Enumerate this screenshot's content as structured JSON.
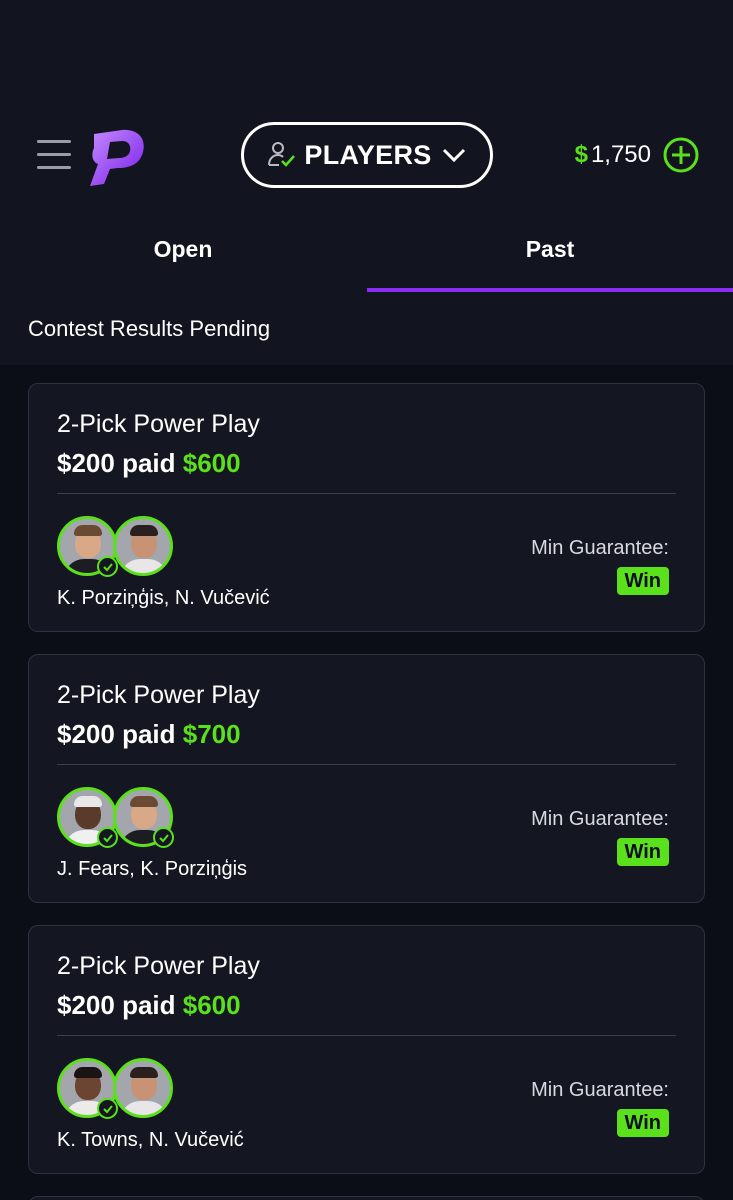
{
  "header": {
    "menu_icon": "hamburger-icon",
    "logo": "prizepicks-logo",
    "mode_label": "PLAYERS",
    "mode_icon": "user-check-icon",
    "balance_currency": "$",
    "balance_amount": "1,750",
    "add_funds_icon": "plus-circle-icon"
  },
  "tabs": [
    {
      "label": "Open",
      "active": false
    },
    {
      "label": "Past",
      "active": true
    }
  ],
  "section_title": "Contest Results Pending",
  "colors": {
    "background": "#0c0e17",
    "header": "#121420",
    "card": "#141722",
    "accent_green": "#5be11c",
    "accent_purple": "#8b2cf5"
  },
  "cards": [
    {
      "title": "2-Pick Power Play",
      "paid_prefix": "$200 paid",
      "payout": "$600",
      "players": "K. Porziņģis, N. Vučević",
      "min_guarantee_label": "Min Guarantee:",
      "result": "Win"
    },
    {
      "title": "2-Pick Power Play",
      "paid_prefix": "$200 paid",
      "payout": "$700",
      "players": "J. Fears, K. Porziņģis",
      "min_guarantee_label": "Min Guarantee:",
      "result": "Win"
    },
    {
      "title": "2-Pick Power Play",
      "paid_prefix": "$200 paid",
      "payout": "$600",
      "players": "K. Towns, N. Vučević",
      "min_guarantee_label": "Min Guarantee:",
      "result": "Win"
    }
  ]
}
